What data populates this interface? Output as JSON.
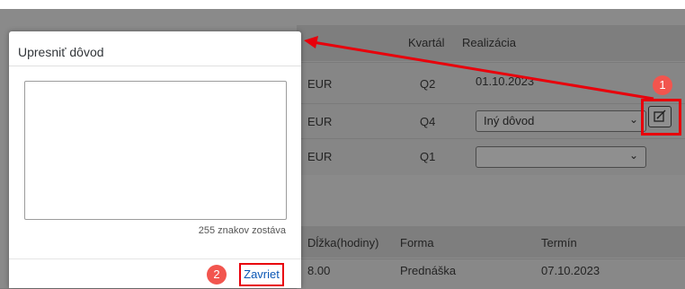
{
  "background_table": {
    "headers": {
      "quarter": "Kvartál",
      "realization": "Realizácia"
    },
    "rows": [
      {
        "currency": "EUR",
        "quarter": "Q2",
        "realization": "01.10.2023"
      },
      {
        "currency": "EUR",
        "quarter": "Q4",
        "realization_select": "Iný dôvod"
      },
      {
        "currency": "EUR",
        "quarter": "Q1",
        "realization_select": ""
      }
    ]
  },
  "background_table2": {
    "headers": {
      "duration": "Dĺžka(hodiny)",
      "form": "Forma",
      "term": "Termín"
    },
    "rows": [
      {
        "duration": "8.00",
        "form": "Prednáška",
        "term": "07.10.2023"
      }
    ]
  },
  "dialog": {
    "title": "Upresniť dôvod",
    "textarea_value": "",
    "counter": "255 znakov zostáva",
    "close_label": "Zavriet"
  },
  "annotations": {
    "callout_1": "1",
    "callout_2": "2",
    "accent_color": "#e8000b"
  },
  "icons": {
    "chevron": "chevron-down-icon",
    "edit": "edit-note-icon"
  }
}
